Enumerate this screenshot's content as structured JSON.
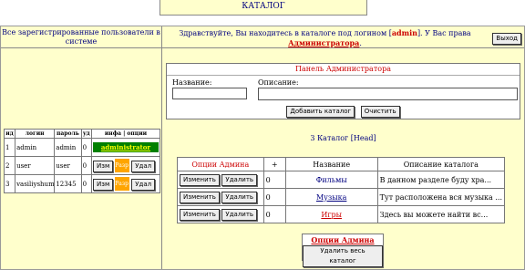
{
  "header": {
    "title": "КАТАЛОГ"
  },
  "left": {
    "heading": "Все зарегистрированные пользователи в системе",
    "columns": [
      "ид",
      "логин",
      "пароль",
      "уд",
      "инфа",
      "опции"
    ],
    "rows": [
      {
        "id": "1",
        "login": "admin",
        "password": "admin",
        "ud": "0",
        "info": "administrator",
        "edit": "",
        "badge": "",
        "del": ""
      },
      {
        "id": "2",
        "login": "user",
        "password": "user",
        "ud": "0",
        "info": "",
        "edit": "Изм",
        "badge": "Разр",
        "del": "Удал"
      },
      {
        "id": "3",
        "login": "vasiliyshumov",
        "password": "12345",
        "ud": "0",
        "info": "",
        "edit": "Изм",
        "badge": "Разр",
        "del": "Удал"
      }
    ]
  },
  "greeting": {
    "text": "Здравствуйте, Вы находитесь в каталоге под логином [",
    "user": "admin",
    "text2": "]. У Вас права",
    "role": "Администратора",
    "period": "."
  },
  "exit_button": "Выход",
  "admin_panel": {
    "title": "Панель Администратора",
    "name_label": "Название:",
    "desc_label": "Описание:",
    "add_button": "Добавить каталог",
    "clear_button": "Очистить"
  },
  "catalog": {
    "title": "3  Каталог [Head]",
    "columns": [
      "Опции Админа",
      "+",
      "Название",
      "Описание каталога"
    ],
    "edit_label": "Изменить",
    "delete_label": "Удалить",
    "rows": [
      {
        "count": "0",
        "name": "Фильмы",
        "desc": "В данном разделе буду хра..."
      },
      {
        "count": "0",
        "name": "Музыка",
        "desc": "Тут расположена вся музыка ..."
      },
      {
        "count": "0",
        "name": "Игры",
        "desc": "Здесь вы можете найти вс..."
      }
    ]
  },
  "bottom": {
    "title": "Опции Админа",
    "button": "Удалить весь каталог"
  },
  "colors": {
    "info_bg": "#008000",
    "info_fg": "#ffff00",
    "badge_bg": "#ffa500",
    "accent": "#cc0000",
    "navy": "#000080"
  }
}
